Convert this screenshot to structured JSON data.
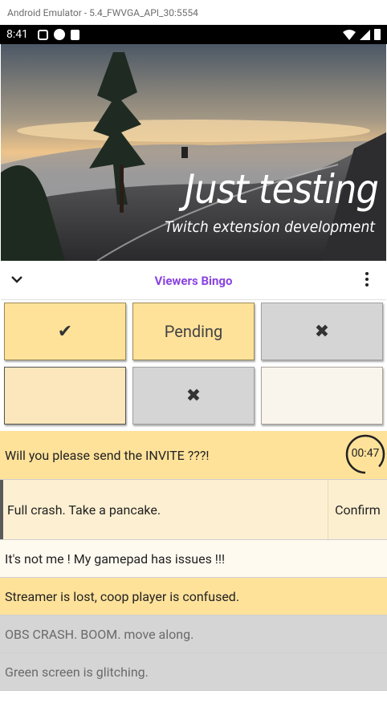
{
  "emulator": {
    "title": "Android Emulator - 5.4_FWVGA_API_30:5554"
  },
  "status_bar": {
    "time": "8:41"
  },
  "banner": {
    "title": "Just testing",
    "subtitle": "Twitch extension development"
  },
  "header": {
    "title": "Viewers Bingo"
  },
  "grid": {
    "cells": [
      {
        "label": "✔",
        "state": "checked"
      },
      {
        "label": "Pending",
        "state": "pending"
      },
      {
        "label": "✖",
        "state": "rejected"
      },
      {
        "label": "",
        "state": "empty"
      },
      {
        "label": "✖",
        "state": "rejected"
      },
      {
        "label": "",
        "state": "empty"
      }
    ]
  },
  "items": [
    {
      "text": "Will you please send the INVITE ???!",
      "timer": "00:47"
    },
    {
      "text": "Full crash. Take a pancake.",
      "action": "Confirm"
    },
    {
      "text": "It's not me ! My gamepad has issues !!!"
    },
    {
      "text": "Streamer is lost, coop player is confused."
    },
    {
      "text": "OBS CRASH. BOOM. move along."
    },
    {
      "text": "Green screen is glitching."
    }
  ],
  "colors": {
    "accent": "#8a44e0",
    "cell_yellow": "#ffe29a",
    "cell_grey": "#d5d5d5"
  }
}
